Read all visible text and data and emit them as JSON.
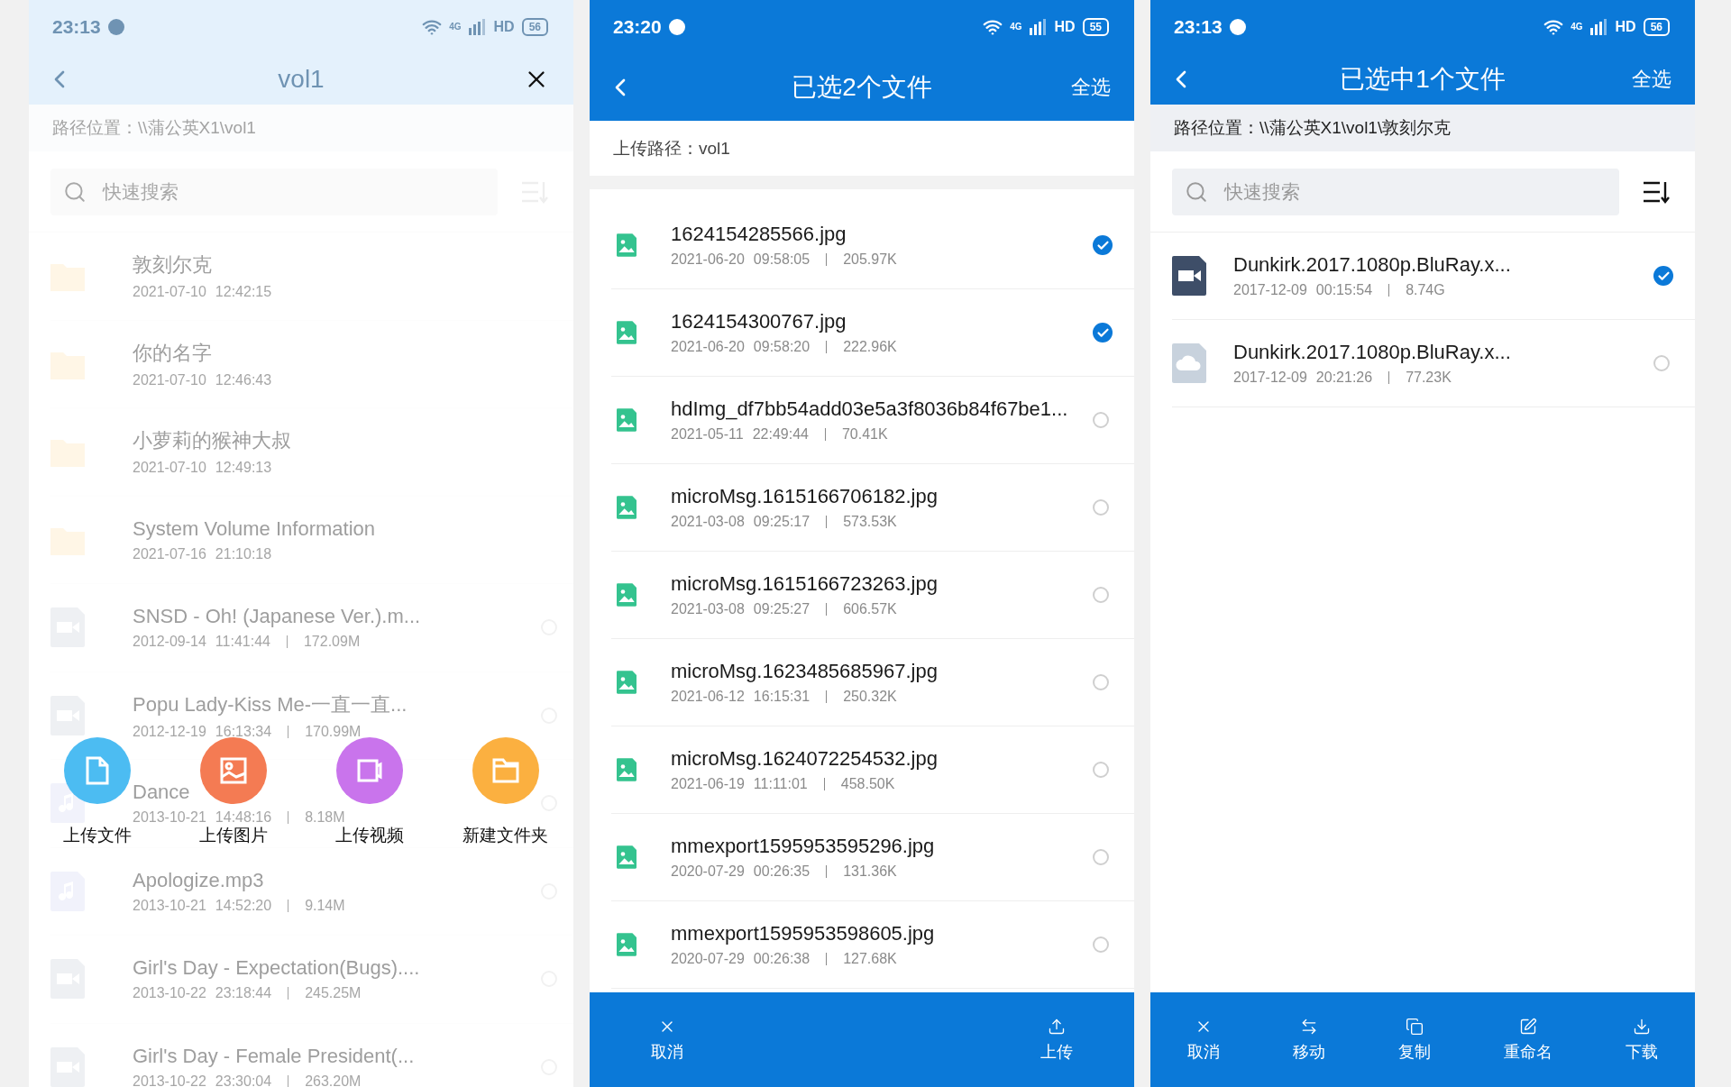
{
  "panels": [
    {
      "faded": true,
      "status": {
        "time": "23:13",
        "network": "4G",
        "hd": "HD",
        "battery": "56"
      },
      "header": {
        "title": "vol1",
        "action": {
          "kind": "close"
        }
      },
      "path": "路径位置：\\\\蒲公英X1\\vol1",
      "search": {
        "placeholder": "快速搜索"
      },
      "items": [
        {
          "kind": "folder",
          "name": "敦刻尔克",
          "date": "2021-07-10",
          "time": "12:42:15"
        },
        {
          "kind": "folder",
          "name": "你的名字",
          "date": "2021-07-10",
          "time": "12:46:43"
        },
        {
          "kind": "folder",
          "name": "小萝莉的猴神大叔",
          "date": "2021-07-10",
          "time": "12:49:13"
        },
        {
          "kind": "folder",
          "name": "System Volume Information",
          "date": "2021-07-16",
          "time": "21:10:18"
        },
        {
          "kind": "video",
          "name": "SNSD - Oh! (Japanese Ver.).m...",
          "date": "2012-09-14",
          "time": "11:41:44",
          "size": "172.09M",
          "selected": false
        },
        {
          "kind": "video",
          "name": "Popu Lady-Kiss Me-一直一直...",
          "date": "2012-12-19",
          "time": "16:13:34",
          "size": "170.99M",
          "selected": false
        },
        {
          "kind": "audio",
          "name": "Dance",
          "date": "2013-10-21",
          "time": "14:48:16",
          "size": "8.18M",
          "selected": false
        },
        {
          "kind": "audio",
          "name": "Apologize.mp3",
          "date": "2013-10-21",
          "time": "14:52:20",
          "size": "9.14M",
          "selected": false
        },
        {
          "kind": "video",
          "name": "Girl's Day - Expectation(Bugs)....",
          "date": "2013-10-22",
          "time": "23:18:44",
          "size": "245.25M",
          "selected": false
        },
        {
          "kind": "video",
          "name": "Girl's Day - Female President(...",
          "date": "2013-10-22",
          "time": "23:30:04",
          "size": "263.20M",
          "selected": false
        }
      ],
      "actions": [
        {
          "kind": "file",
          "label": "上传文件",
          "color": "#4cbcf2"
        },
        {
          "kind": "image",
          "label": "上传图片",
          "color": "#f47b53"
        },
        {
          "kind": "video",
          "label": "上传视频",
          "color": "#c974ec"
        },
        {
          "kind": "folder",
          "label": "新建文件夹",
          "color": "#fbb040"
        }
      ]
    },
    {
      "faded": false,
      "status": {
        "time": "23:20",
        "network": "4G",
        "hd": "HD",
        "battery": "55"
      },
      "header": {
        "title": "已选2个文件",
        "action": {
          "kind": "text",
          "label": "全选"
        }
      },
      "path": "上传路径：vol1",
      "items": [
        {
          "kind": "image",
          "name": "1624154285566.jpg",
          "date": "2021-06-20",
          "time": "09:58:05",
          "size": "205.97K",
          "selected": true
        },
        {
          "kind": "image",
          "name": "1624154300767.jpg",
          "date": "2021-06-20",
          "time": "09:58:20",
          "size": "222.96K",
          "selected": true
        },
        {
          "kind": "image",
          "name": "hdImg_df7bb54add03e5a3f8036b84f67be1...",
          "date": "2021-05-11",
          "time": "22:49:44",
          "size": "70.41K",
          "selected": false
        },
        {
          "kind": "image",
          "name": "microMsg.1615166706182.jpg",
          "date": "2021-03-08",
          "time": "09:25:17",
          "size": "573.53K",
          "selected": false
        },
        {
          "kind": "image",
          "name": "microMsg.1615166723263.jpg",
          "date": "2021-03-08",
          "time": "09:25:27",
          "size": "606.57K",
          "selected": false
        },
        {
          "kind": "image",
          "name": "microMsg.1623485685967.jpg",
          "date": "2021-06-12",
          "time": "16:15:31",
          "size": "250.32K",
          "selected": false
        },
        {
          "kind": "image",
          "name": "microMsg.1624072254532.jpg",
          "date": "2021-06-19",
          "time": "11:11:01",
          "size": "458.50K",
          "selected": false
        },
        {
          "kind": "image",
          "name": "mmexport1595953595296.jpg",
          "date": "2020-07-29",
          "time": "00:26:35",
          "size": "131.36K",
          "selected": false
        },
        {
          "kind": "image",
          "name": "mmexport1595953598605.jpg",
          "date": "2020-07-29",
          "time": "00:26:38",
          "size": "127.68K",
          "selected": false
        }
      ],
      "toolbar": [
        {
          "kind": "cancel",
          "label": "取消"
        },
        {
          "kind": "upload",
          "label": "上传"
        }
      ]
    },
    {
      "faded": false,
      "status": {
        "time": "23:13",
        "network": "4G",
        "hd": "HD",
        "battery": "56"
      },
      "header": {
        "title": "已选中1个文件",
        "action": {
          "kind": "text",
          "label": "全选"
        }
      },
      "path": "路径位置：\\\\蒲公英X1\\vol1\\敦刻尔克",
      "search": {
        "placeholder": "快速搜索"
      },
      "items": [
        {
          "kind": "video",
          "name": "Dunkirk.2017.1080p.BluRay.x...",
          "date": "2017-12-09",
          "time": "00:15:54",
          "size": "8.74G",
          "selected": true
        },
        {
          "kind": "cloud",
          "name": "Dunkirk.2017.1080p.BluRay.x...",
          "date": "2017-12-09",
          "time": "20:21:26",
          "size": "77.23K",
          "selected": false
        }
      ],
      "toolbar": [
        {
          "kind": "cancel",
          "label": "取消"
        },
        {
          "kind": "move",
          "label": "移动"
        },
        {
          "kind": "copy",
          "label": "复制"
        },
        {
          "kind": "rename",
          "label": "重命名"
        },
        {
          "kind": "download",
          "label": "下载"
        }
      ]
    }
  ]
}
